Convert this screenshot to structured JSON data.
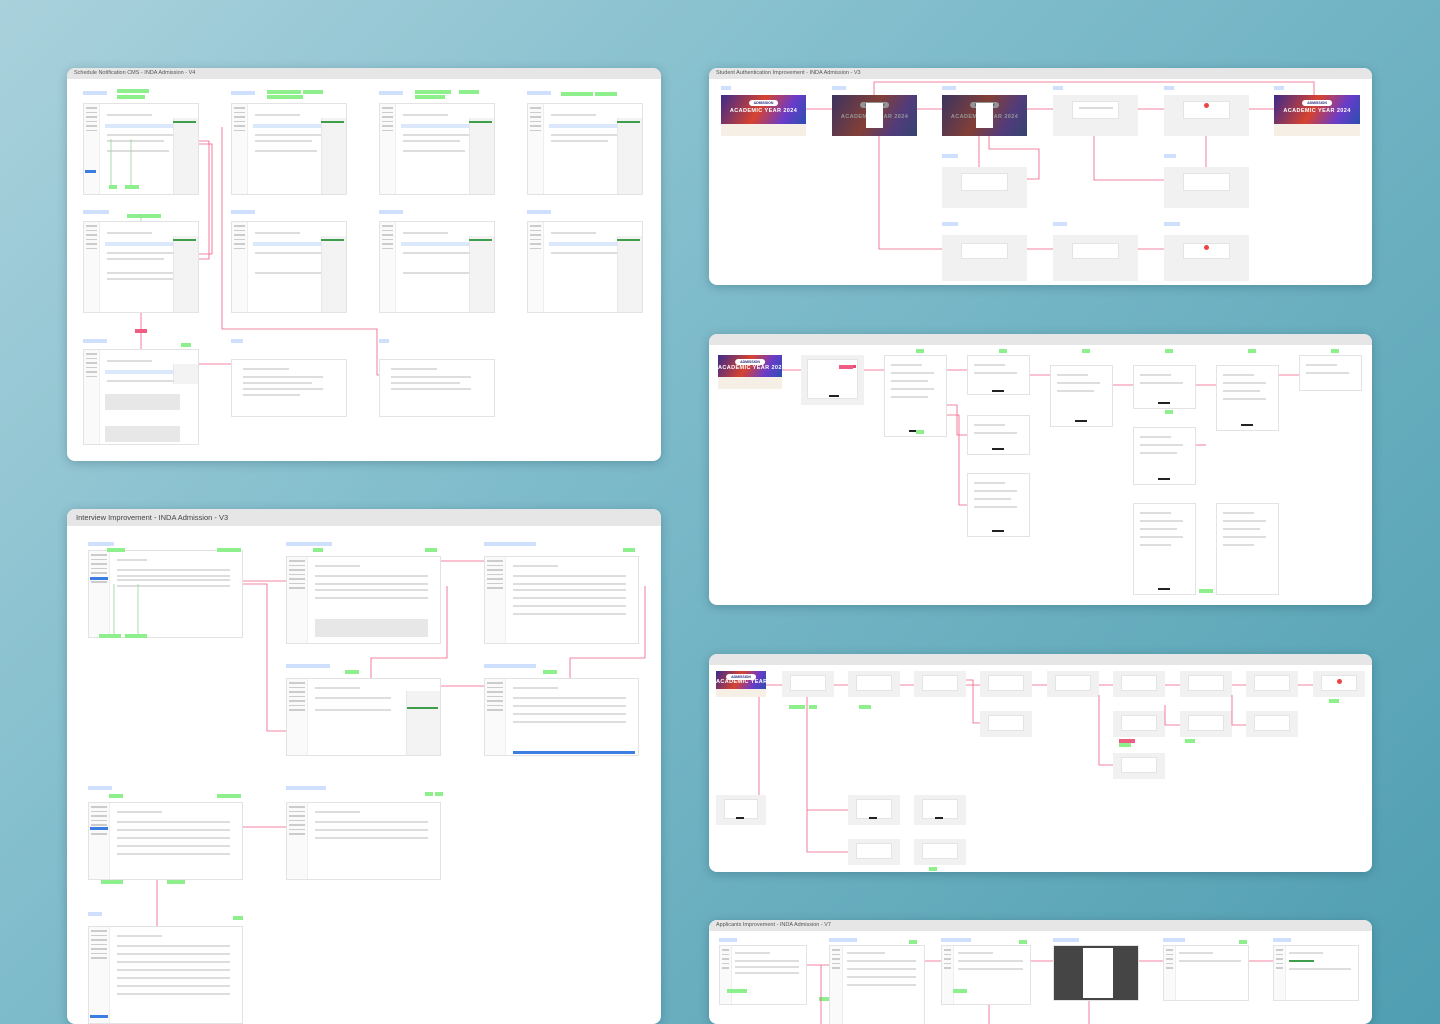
{
  "boards": [
    {
      "id": "schedule",
      "title": "Schedule Notification CMS - INDA Admission - V4"
    },
    {
      "id": "studentauth",
      "title": "Student Authentication Improvement - INDA Admission - V3"
    },
    {
      "id": "interview",
      "title": "Interview Improvement - INDA Admission - V3"
    },
    {
      "id": "applicants",
      "title": "Applicants Improvement - INDA Admission - V7"
    }
  ],
  "hero": {
    "badge": "ADMISSION",
    "title": "ACADEMIC YEAR 2024"
  },
  "colors": {
    "background": "#5aa6b8",
    "annotation": "#8ef08c",
    "annotation_alert": "#f05d83",
    "screen_label": "#cfe0ff",
    "flow_line": "#f05d83",
    "primary_blue": "#3b7de0",
    "primary_green": "#3f9e4a"
  }
}
